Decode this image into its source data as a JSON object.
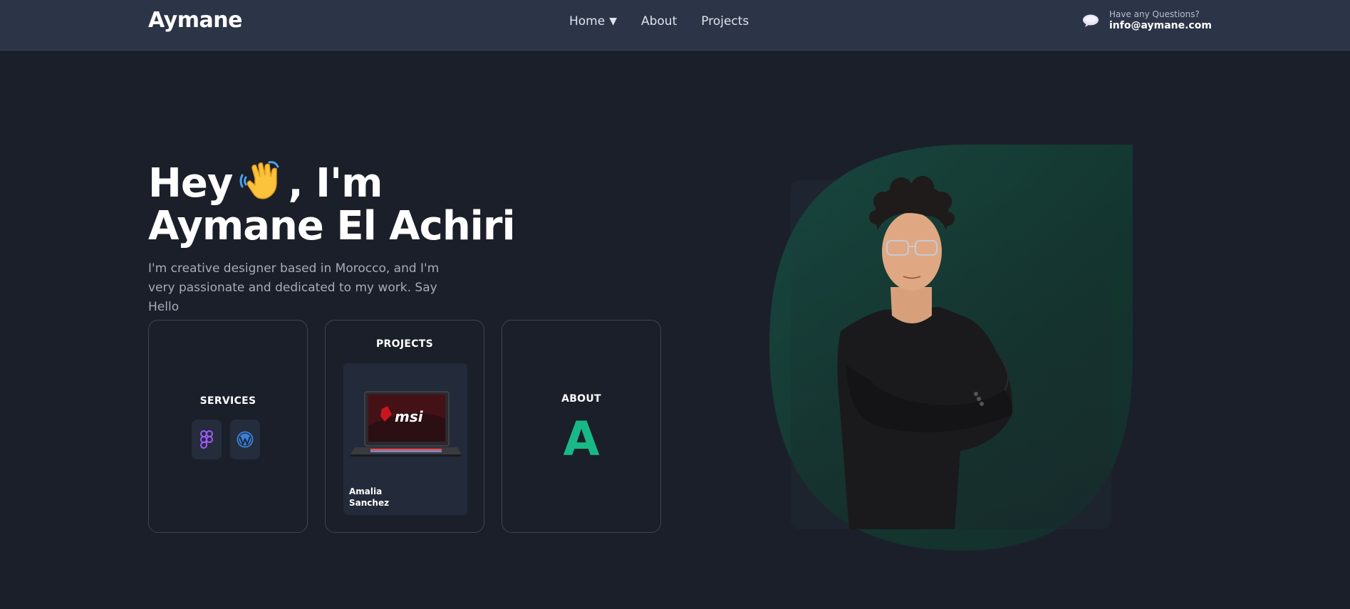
{
  "header": {
    "logo": "Aymane",
    "nav": [
      {
        "label": "Home",
        "has_caret": true,
        "caret": "▼"
      },
      {
        "label": "About"
      },
      {
        "label": "Projects"
      }
    ],
    "contact": {
      "question": "Have any Questions?",
      "email": "info@aymane.com",
      "icon": "chat-bubble-icon"
    }
  },
  "hero": {
    "title_line1_start": "Hey",
    "title_line1_end": ", I'm",
    "title_line2": "Aymane El Achiri",
    "wave_icon": "waving-hand-icon",
    "description": "I'm creative designer based in Morocco, and I'm very passionate and dedicated to my work. Say Hello"
  },
  "cards": {
    "services": {
      "title": "SERVICES",
      "icons": [
        "figma-icon",
        "wordpress-icon"
      ]
    },
    "projects": {
      "title": "PROJECTS",
      "project_name": "Amalia Sanchez",
      "thumbnail": "msi-laptop-image"
    },
    "about": {
      "title": "ABOUT",
      "letter": "A"
    }
  },
  "colors": {
    "background": "#1b1f2a",
    "header": "#2c3448",
    "accent_green": "#19b887",
    "portrait_blob": "#15463e"
  }
}
